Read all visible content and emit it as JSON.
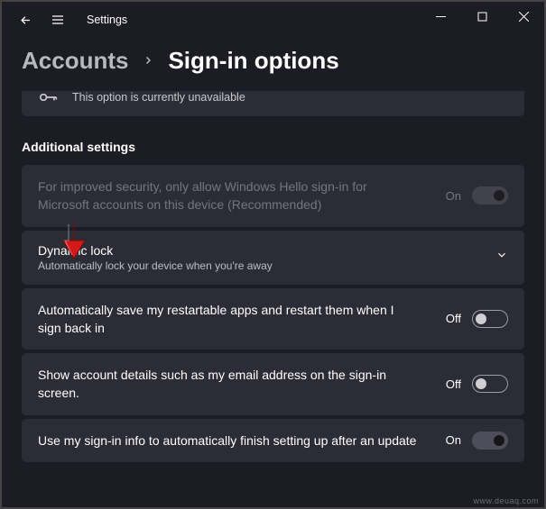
{
  "window": {
    "app_title": "Settings"
  },
  "breadcrumb": {
    "parent": "Accounts",
    "current": "Sign-in options"
  },
  "unavailable_notice": "This option is currently unavailable",
  "section_heading": "Additional settings",
  "rows": {
    "hello_only": {
      "title": "For improved security, only allow Windows Hello sign-in for Microsoft accounts on this device (Recommended)",
      "state_label": "On",
      "state": true,
      "disabled": true
    },
    "dynamic_lock": {
      "title": "Dynamic lock",
      "subtitle": "Automatically lock your device when you're away",
      "expandable": true
    },
    "restartable_apps": {
      "title": "Automatically save my restartable apps and restart them when I sign back in",
      "state_label": "Off",
      "state": false
    },
    "account_details": {
      "title": "Show account details such as my email address on the sign-in screen.",
      "state_label": "Off",
      "state": false
    },
    "finish_setup": {
      "title": "Use my sign-in info to automatically finish setting up after an update",
      "state_label": "On",
      "state": true
    }
  },
  "watermark": "www.deuaq.com"
}
